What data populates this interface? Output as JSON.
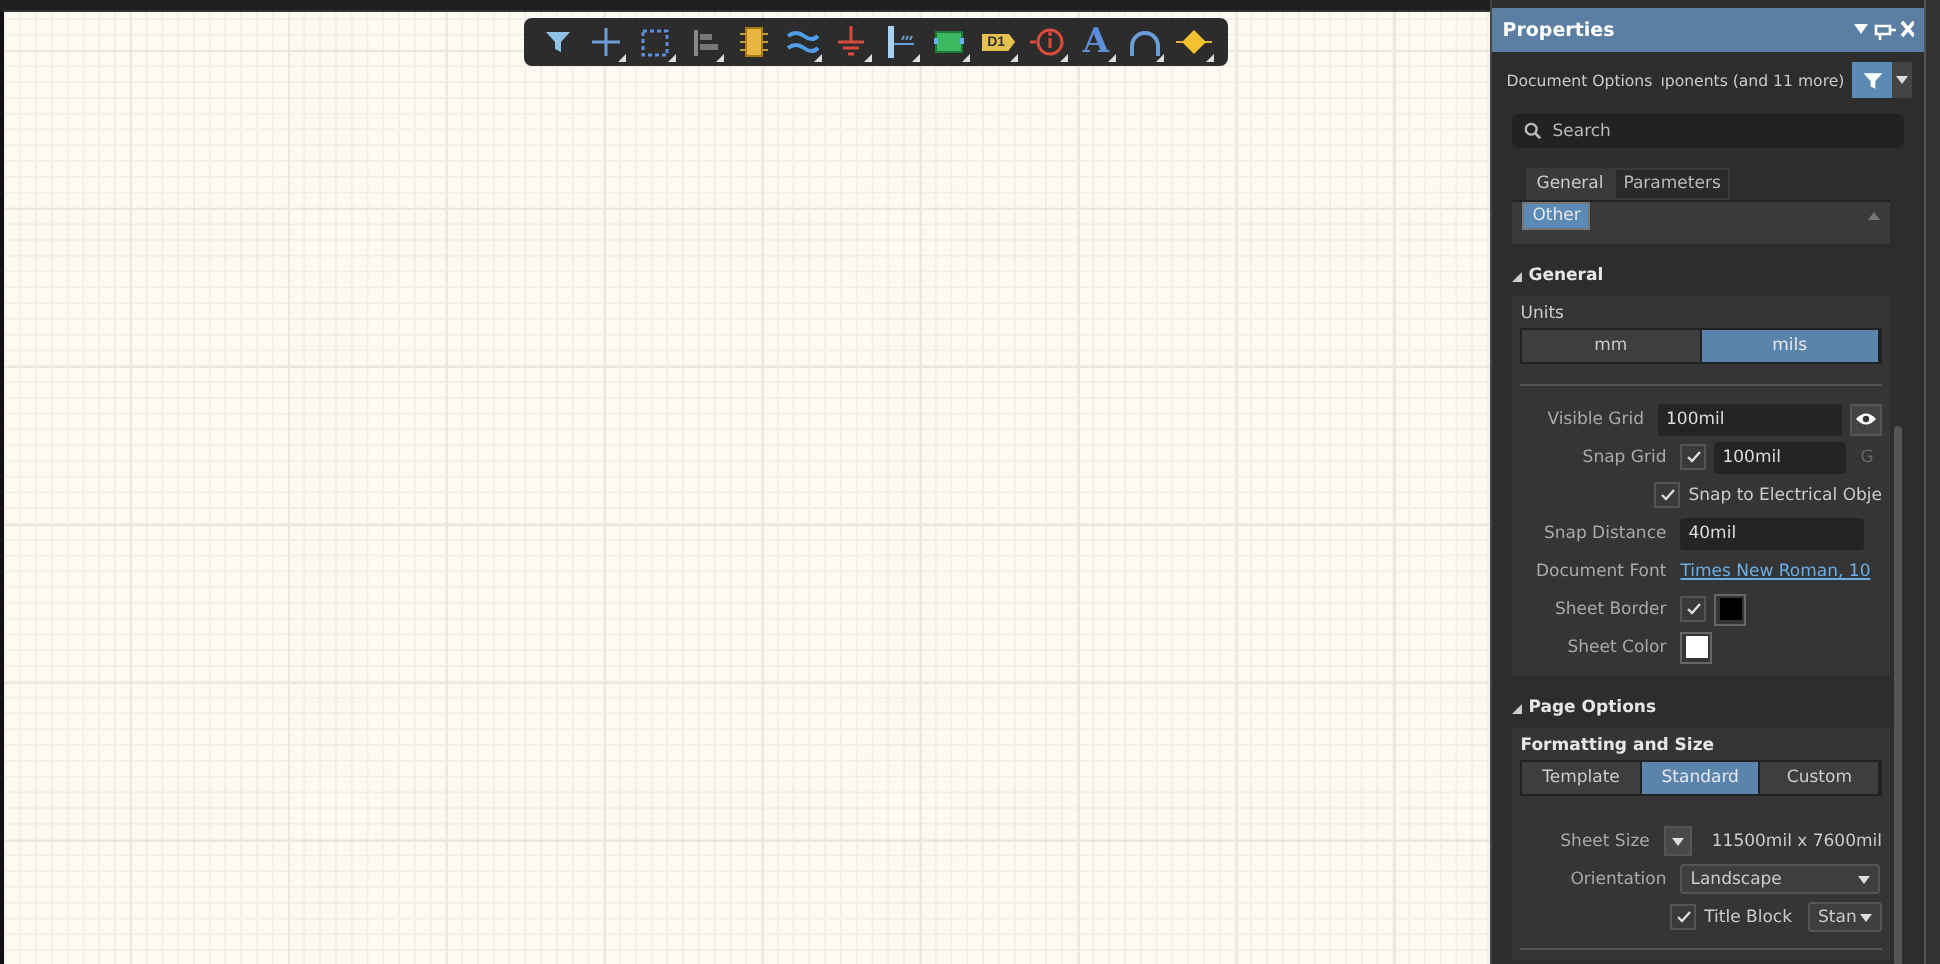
{
  "toolbar": {
    "tools": [
      {
        "kind": "filter",
        "dropdown": false
      },
      {
        "kind": "cross",
        "dropdown": true
      },
      {
        "kind": "select",
        "dropdown": true
      },
      {
        "kind": "align",
        "dropdown": true
      },
      {
        "kind": "component",
        "dropdown": false
      },
      {
        "kind": "bus",
        "dropdown": true
      },
      {
        "kind": "ground",
        "dropdown": true
      },
      {
        "kind": "port",
        "dropdown": true
      },
      {
        "kind": "sheet",
        "dropdown": true
      },
      {
        "kind": "netlabel",
        "label": "D1",
        "dropdown": true
      },
      {
        "kind": "info",
        "dropdown": true
      },
      {
        "kind": "text",
        "label": "A",
        "dropdown": true
      },
      {
        "kind": "arc",
        "dropdown": true
      },
      {
        "kind": "pin",
        "dropdown": true
      }
    ]
  },
  "panel": {
    "title": "Properties",
    "filter": {
      "label": "Document Options",
      "value": "ıponents (and 11 more)"
    },
    "search": {
      "placeholder": "Search"
    },
    "tabs": [
      {
        "label": "General",
        "selected": true
      },
      {
        "label": "Parameters",
        "selected": false
      }
    ],
    "chip": "Other",
    "sections": [
      {
        "title": "General",
        "expanded": true,
        "group_label": "Units",
        "segments": [
          {
            "label": "mm",
            "selected": false
          },
          {
            "label": "mils",
            "selected": true
          }
        ],
        "rows": [
          {
            "kind": "field",
            "label": "Visible Grid",
            "value": "100mil"
          },
          {
            "kind": "check-field",
            "label": "Snap Grid",
            "checked": true,
            "value": "100mil",
            "suffix": "G"
          },
          {
            "kind": "check",
            "label": "Snap to Electrical Obje",
            "checked": true
          },
          {
            "kind": "field",
            "label": "Snap Distance",
            "value": "40mil"
          },
          {
            "kind": "link",
            "label": "Document Font",
            "value": "Times New Roman, 10"
          },
          {
            "kind": "check-swatch",
            "label": "Sheet Border",
            "checked": true,
            "color": "#000000"
          },
          {
            "kind": "swatch",
            "label": "Sheet Color",
            "color": "#ffffff"
          }
        ]
      },
      {
        "title": "Page Options",
        "expanded": true,
        "group_label": "Formatting and Size",
        "segments": [
          {
            "label": "Template",
            "selected": false
          },
          {
            "label": "Standard",
            "selected": true
          },
          {
            "label": "Custom",
            "selected": false
          }
        ],
        "rows": [
          {
            "kind": "size",
            "label": "Sheet Size",
            "value": "11500mil x 7600mil"
          },
          {
            "kind": "select",
            "label": "Orientation",
            "value": "Landscape"
          },
          {
            "kind": "check-select",
            "label": "Title Block",
            "checked": true,
            "value": "Stan"
          }
        ]
      }
    ]
  }
}
